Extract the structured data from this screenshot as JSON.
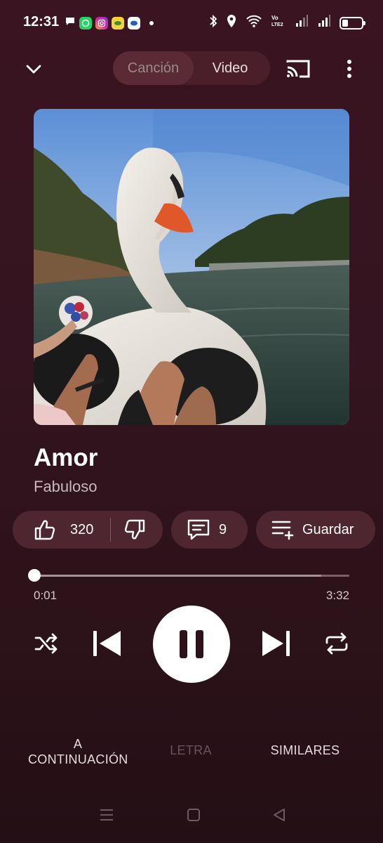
{
  "status_bar": {
    "time": "12:31",
    "notifications": [
      "chat-bubble-icon",
      "whatsapp-icon",
      "instagram-icon",
      "app-icon-yellow",
      "app-icon-blue"
    ],
    "battery_level": 0.3
  },
  "header": {
    "toggle": {
      "song_label": "Canción",
      "video_label": "Video",
      "selected": "Canción"
    }
  },
  "track": {
    "title": "Amor",
    "artist": "Fabuloso"
  },
  "actions": {
    "likes": "320",
    "comments": "9",
    "save_label": "Guardar"
  },
  "progress": {
    "current": "0:01",
    "total": "3:32",
    "played_fraction": 0.005,
    "buffered_fraction": 0.91
  },
  "tabs": {
    "next_label": "A CONTINUACIÓN",
    "lyrics_label": "LETRA",
    "similar_label": "SIMILARES"
  },
  "colors": {
    "background": "#3a1420",
    "chip": "#4d2630",
    "accent": "#ffffff"
  }
}
